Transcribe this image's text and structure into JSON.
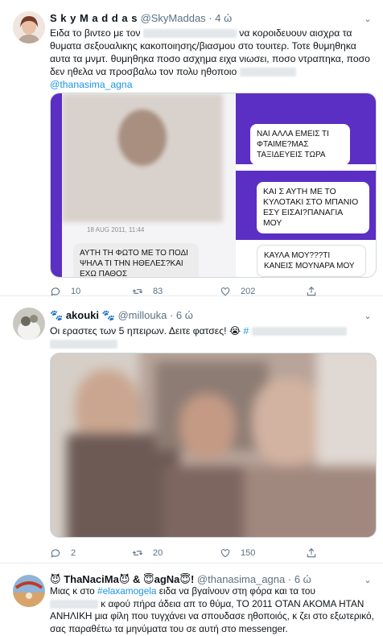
{
  "tweet1": {
    "name": "S k y M a d d a s",
    "handle": "@SkyMaddas",
    "time": "· 4 ώ",
    "text_a": "Ειδα το βιντεο με τον",
    "text_b": "να κοροιδευουν αισχρα τα θυματα σεξουαλικης κακοποιησης/βιασμου στο τουιτερ. Τοτε θυμηθηκα αυτα τα μνμτ. θυμηθηκα ποσο ασχημα ειχα νιωσει, ποσο ντραπηκα, ποσο δεν ηθελα να προσβαλω τον πολυ  ηθοποιο",
    "mention": "@thanasima_agna",
    "media": {
      "date": "18 AUG 2011, 11:44",
      "bubbles": [
        "ΝΑΙ ΑΛΛΑ ΕΜΕΙΣ ΤΙ ΦΤΑΙΜΕ?ΜΑΣ ΤΑΞΙΔΕΥΕΙΣ ΤΩΡΑ",
        "ΚΑΙ Σ ΑΥΤΗ ΜΕ ΤΟ ΚΥΛΟΤΑΚΙ ΣΤΟ ΜΠΑΝΙΟ ΕΣΥ ΕΙΣΑΙ?ΠΑΝΑΓΙΑ ΜΟΥ",
        "ΑΥΤΗ ΤΗ ΦΩΤΟ ΜΕ ΤΟ ΠΟΔΙ ΨΗΛΑ ΤΙ ΤΗΝ ΗΘΕΛΕΣ?ΚΑΙ ΕΧΩ ΠΑΘΟΣ",
        "ΚΑΥΛΑ ΜΟΥ???ΤΙ ΚΑΝΕΙΣ ΜΟΥΝΑΡΑ ΜΟΥ"
      ]
    },
    "replies": "10",
    "retweets": "83",
    "likes": "202"
  },
  "tweet2": {
    "name": "akouki",
    "handle": "@millouka",
    "time": "· 6 ώ",
    "text": "Οι εραστες των 5 ηπειρων. Δειτε φατσες!",
    "replies": "2",
    "retweets": "20",
    "likes": "150"
  },
  "tweet3": {
    "name_a": "ThaNaciMa",
    "name_b": "&",
    "name_c": "agNa",
    "name_d": "!",
    "handle": "@thanasima_agna",
    "time": "· 6 ώ",
    "text_a": "Μιας κ στο",
    "hashtag": "#elaxamogela",
    "text_b": "ειδα να βγαίνουν στη φόρα και τα του",
    "text_c": "κ αφού πήρα άδεια απ το θύμα, ΤΟ 2011 ΟΤΑΝ ΑΚΟΜΑ ΗΤΑΝ ΑΝΗΛΙΚΗ μια φίλη που τυγχάνει να σπουδασε ηθοποιός,  κ ζει στο εξωτερικό, σας παραθέτω τα μηνύματα του σε αυτή στο messenger."
  },
  "colors": {
    "accent": "#1b95e0",
    "muted": "#5b7083",
    "messenger_purple": "#5b2ec4"
  }
}
